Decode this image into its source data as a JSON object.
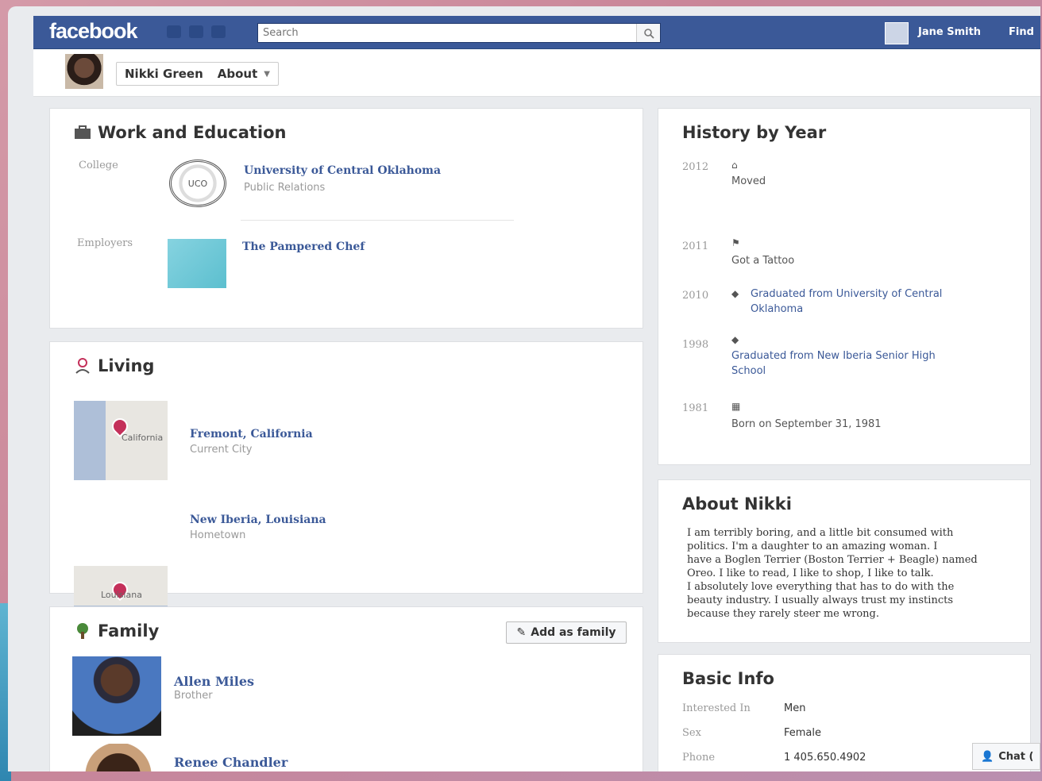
{
  "topbar": {
    "logo": "facebook",
    "search_placeholder": "Search",
    "user_name": "Jane Smith",
    "find_label": "Find"
  },
  "profile": {
    "name": "Nikki Green",
    "section": "About"
  },
  "work": {
    "title": "Work and Education",
    "college_label": "College",
    "college_name": "University of Central Oklahoma",
    "college_sub": "Public Relations",
    "employers_label": "Employers",
    "employer_name": "The Pampered Chef"
  },
  "living": {
    "title": "Living",
    "places": [
      {
        "name": "Fremont, California",
        "sub": "Current City",
        "map_label": "California"
      },
      {
        "name": "New Iberia, Louisiana",
        "sub": "Hometown",
        "map_label": "Louisiana"
      }
    ]
  },
  "family": {
    "title": "Family",
    "add_label": "Add as family",
    "members": [
      {
        "name": "Allen Miles",
        "relation": "Brother"
      },
      {
        "name": "Renee Chandler",
        "relation": ""
      }
    ]
  },
  "history": {
    "title": "History by Year",
    "events": [
      {
        "year": "2012",
        "icon": "house-icon",
        "text": "Moved"
      },
      {
        "year": "2011",
        "icon": "flag-icon",
        "text": "Got a Tattoo"
      },
      {
        "year": "2010",
        "icon": "graduation-cap-icon",
        "text": "Graduated from University of Central Oklahoma"
      },
      {
        "year": "1998",
        "icon": "graduation-cap-icon",
        "text": "Graduated from New Iberia Senior High School"
      },
      {
        "year": "1981",
        "icon": "calendar-icon",
        "text": "Born on September 31, 1981"
      }
    ]
  },
  "about": {
    "title": "About Nikki",
    "lines": [
      "I am terribly boring, and a little bit consumed with",
      "politics.  I'm a daughter to an amazing woman.  I",
      "have a Boglen Terrier (Boston Terrier + Beagle) named",
      "Oreo. I like to read, I like to shop, I like to talk.",
      "I absolutely love everything that has to do with the",
      "beauty industry. I usually always trust my instincts",
      "because they rarely steer me wrong."
    ]
  },
  "basic_info": {
    "title": "Basic Info",
    "rows": [
      {
        "label": "Interested In",
        "value": "Men"
      },
      {
        "label": "Sex",
        "value": "Female"
      },
      {
        "label": "Phone",
        "value": "1 405.650.4902"
      }
    ]
  },
  "chat": {
    "label": "Chat ("
  },
  "colors": {
    "brand": "#3b5998",
    "link": "#3b5998",
    "pin": "#c4305a"
  }
}
